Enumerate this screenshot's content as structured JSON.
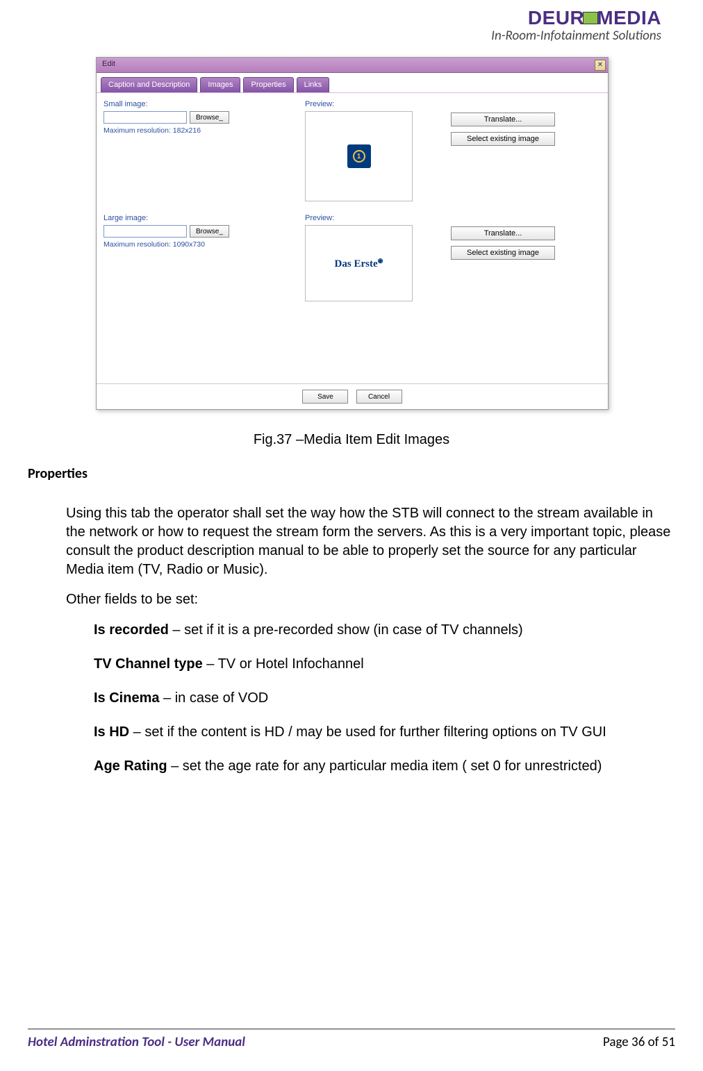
{
  "header": {
    "brand_prefix": "DEUR",
    "brand_suffix": "MEDIA",
    "tagline": "In-Room-Infotainment Solutions"
  },
  "dialog": {
    "title": "Edit",
    "tabs": {
      "caption": "Caption and Description",
      "images": "Images",
      "properties": "Properties",
      "links": "Links"
    },
    "small_image_label": "Small image:",
    "large_image_label": "Large image:",
    "browse": "Browse_",
    "max_res_small": "Maximum resolution: 182x216",
    "max_res_large": "Maximum resolution: 1090x730",
    "preview_label": "Preview:",
    "translate": "Translate...",
    "select_existing": "Select existing image",
    "das_erste": "Das Erste",
    "save": "Save",
    "cancel": "Cancel"
  },
  "caption": "Fig.37 –Media Item Edit Images",
  "section_heading": "Properties",
  "para1": "Using this tab the operator shall set the way how the STB will connect to the stream available in the network or how to request the stream form the servers. As this is a very important topic, please consult the product description manual to be able to properly set the source for any particular Media item (TV, Radio or Music).",
  "para2": "Other fields to be set:",
  "defs": {
    "is_recorded_t": "Is recorded",
    "is_recorded_d": " – set if it is a pre-recorded show (in case of TV channels)",
    "tvch_t": "TV Channel type",
    "tvch_d": " – TV or Hotel Infochannel",
    "cinema_t": "Is Cinema",
    "cinema_d": " – in case of VOD",
    "hd_t": "Is HD",
    "hd_d": " – set if the content is HD / may be used for further filtering options on TV GUI",
    "age_t": "Age Rating",
    "age_d": " – set the age rate for any particular media item ( set 0 for unrestricted)"
  },
  "footer": {
    "left": "Hotel Adminstration Tool - User Manual",
    "right": "Page 36 of 51"
  }
}
